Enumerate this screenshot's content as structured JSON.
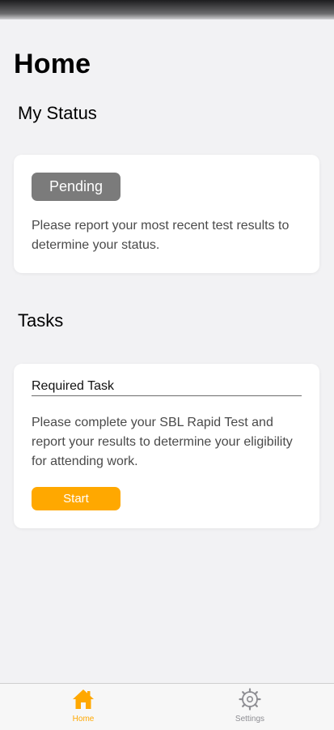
{
  "header": {
    "title": "Home"
  },
  "status": {
    "section_title": "My Status",
    "badge": "Pending",
    "message": "Please report your most recent test results to determine your status."
  },
  "tasks": {
    "section_title": "Tasks",
    "card": {
      "heading": "Required Task",
      "message": "Please complete your SBL Rapid Test and report your results to determine your eligibility for attending work.",
      "button_label": "Start"
    }
  },
  "tabbar": {
    "items": [
      {
        "label": "Home",
        "icon": "house-icon",
        "active": true
      },
      {
        "label": "Settings",
        "icon": "gear-icon",
        "active": false
      }
    ]
  },
  "colors": {
    "accent": "#ffa800",
    "badge": "#7b7b7b",
    "inactive": "#8e8e93"
  }
}
